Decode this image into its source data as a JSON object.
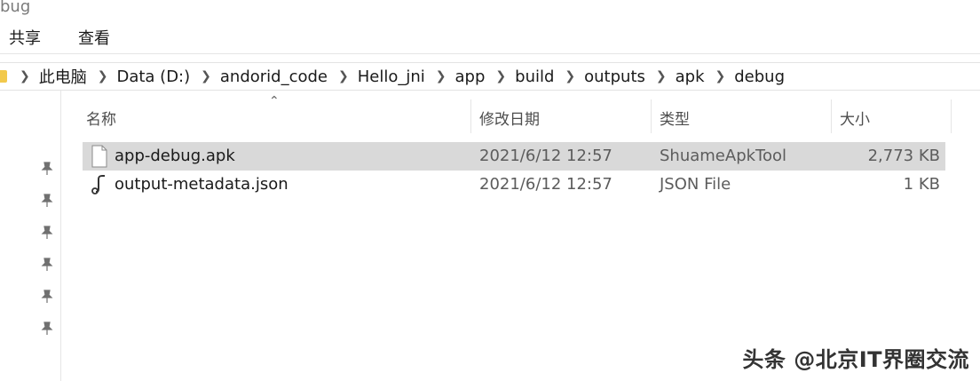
{
  "window": {
    "title": "bug"
  },
  "ribbon": {
    "tabs": [
      "共享",
      "查看"
    ]
  },
  "breadcrumb": [
    "此电脑",
    "Data (D:)",
    "andorid_code",
    "Hello_jni",
    "app",
    "build",
    "outputs",
    "apk",
    "debug"
  ],
  "columns": {
    "name": "名称",
    "date": "修改日期",
    "type": "类型",
    "size": "大小"
  },
  "files": [
    {
      "name": "app-debug.apk",
      "date": "2021/6/12 12:57",
      "type": "ShuameApkTool",
      "size": "2,773 KB",
      "icon": "file-icon",
      "selected": true
    },
    {
      "name": "output-metadata.json",
      "date": "2021/6/12 12:57",
      "type": "JSON File",
      "size": "1 KB",
      "icon": "json-file-icon",
      "selected": false
    }
  ],
  "watermark": "头条 @北京IT界圈交流",
  "colors": {
    "selection": "#d9d9d9",
    "folder": "#f2c94c"
  }
}
